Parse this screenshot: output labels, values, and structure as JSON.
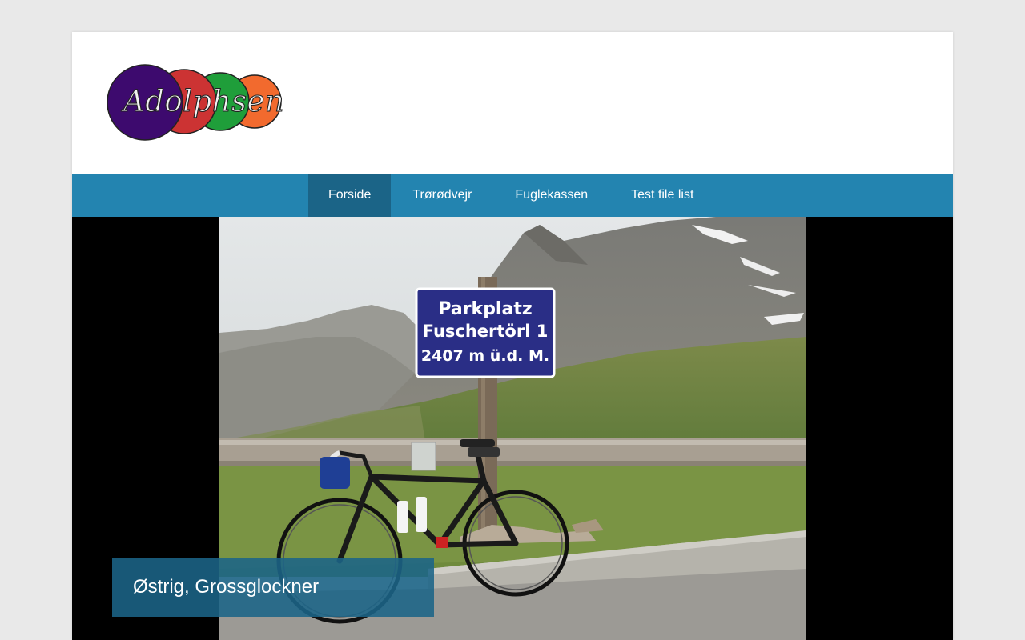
{
  "site": {
    "logo_text": "Adolphsen",
    "logo_colors": [
      "#3d0a6e",
      "#cc3333",
      "#1f9e3a",
      "#f26a2e"
    ]
  },
  "nav": {
    "items": [
      {
        "label": "Forside",
        "active": true
      },
      {
        "label": "Trørødvejr",
        "active": false
      },
      {
        "label": "Fuglekassen",
        "active": false
      },
      {
        "label": "Test file list",
        "active": false
      }
    ],
    "bar_color": "#2384b0",
    "active_color": "#1b6487"
  },
  "slider": {
    "caption": "Østrig, Grossglockner",
    "sign": {
      "line1": "Parkplatz",
      "line2": "Fuschertörl 1",
      "line3": "2407 m ü.d. M."
    }
  }
}
